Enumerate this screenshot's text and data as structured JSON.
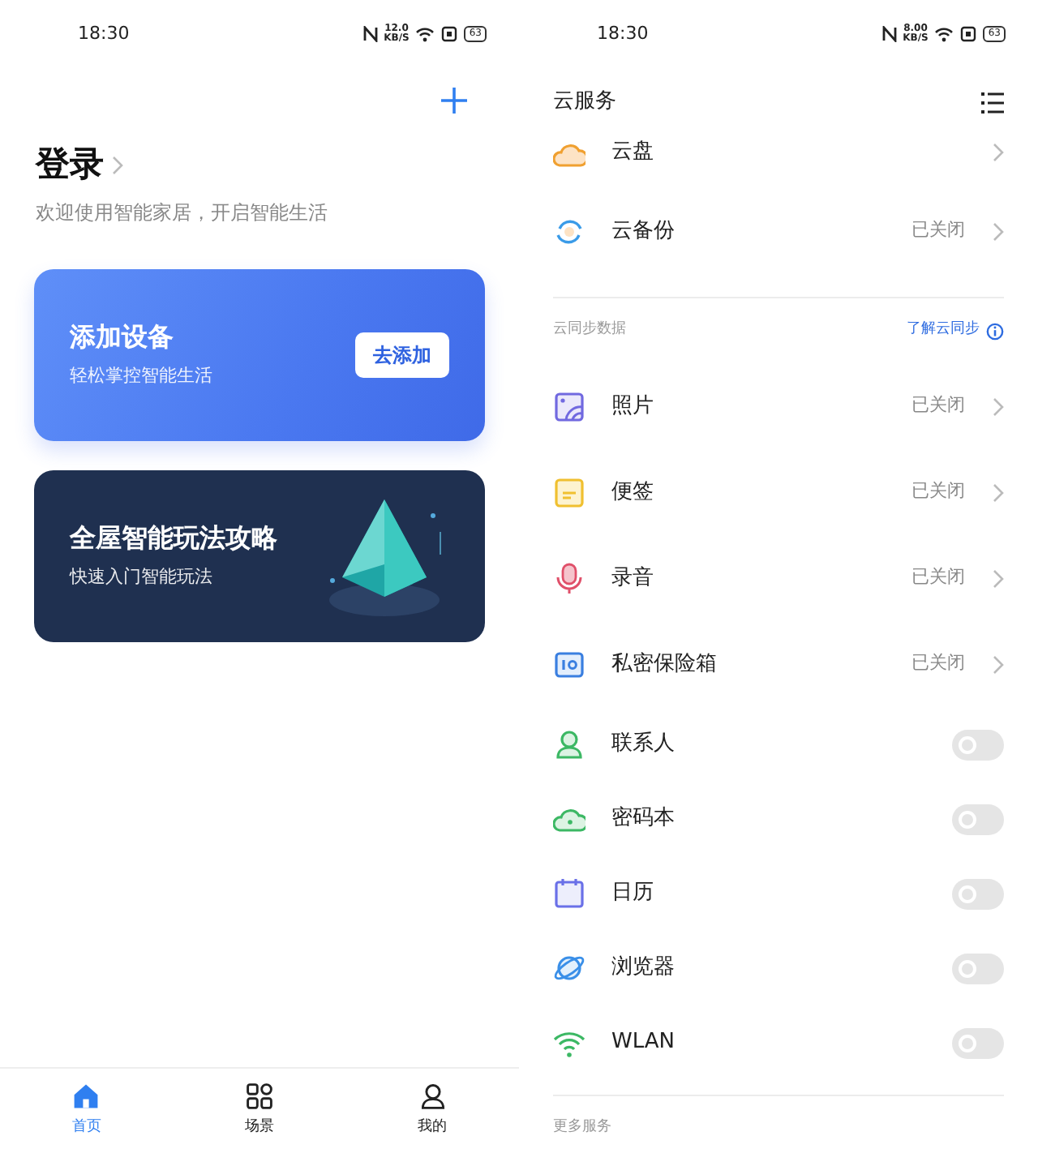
{
  "left": {
    "status_bar": {
      "time": "18:30",
      "speed": "12.0",
      "speed_unit": "KB/S",
      "battery": "63"
    },
    "login": {
      "title": "登录",
      "subtitle": "欢迎使用智能家居，开启智能生活"
    },
    "cards": [
      {
        "kind": "add",
        "title": "添加设备",
        "subtitle": "轻松掌控智能生活",
        "button": "去添加"
      },
      {
        "kind": "guide",
        "title": "全屋智能玩法攻略",
        "subtitle": "快速入门智能玩法"
      }
    ],
    "bottom_nav": [
      {
        "label": "首页",
        "selected": true
      },
      {
        "label": "场景",
        "selected": false
      },
      {
        "label": "我的",
        "selected": false
      }
    ]
  },
  "right": {
    "status_bar": {
      "time": "18:30",
      "speed": "8.00",
      "speed_unit": "KB/S",
      "battery": "63"
    },
    "title": "云服务",
    "rows": [
      {
        "kind": "link",
        "label": "云盘"
      },
      {
        "kind": "link",
        "label": "云备份",
        "status": "已关闭"
      }
    ],
    "sync_section": {
      "title": "云同步数据",
      "link": "了解云同步",
      "rows": [
        {
          "kind": "link",
          "label": "照片",
          "status": "已关闭"
        },
        {
          "kind": "link",
          "label": "便签",
          "status": "已关闭"
        },
        {
          "kind": "link",
          "label": "录音",
          "status": "已关闭"
        },
        {
          "kind": "link",
          "label": "私密保险箱",
          "status": "已关闭"
        },
        {
          "kind": "toggle",
          "label": "联系人",
          "on": false
        },
        {
          "kind": "toggle",
          "label": "密码本",
          "on": false
        },
        {
          "kind": "toggle",
          "label": "日历",
          "on": false
        },
        {
          "kind": "toggle",
          "label": "浏览器",
          "on": false
        },
        {
          "kind": "toggle",
          "label": "WLAN",
          "on": false
        }
      ]
    },
    "more_section": {
      "title": "更多服务"
    }
  }
}
